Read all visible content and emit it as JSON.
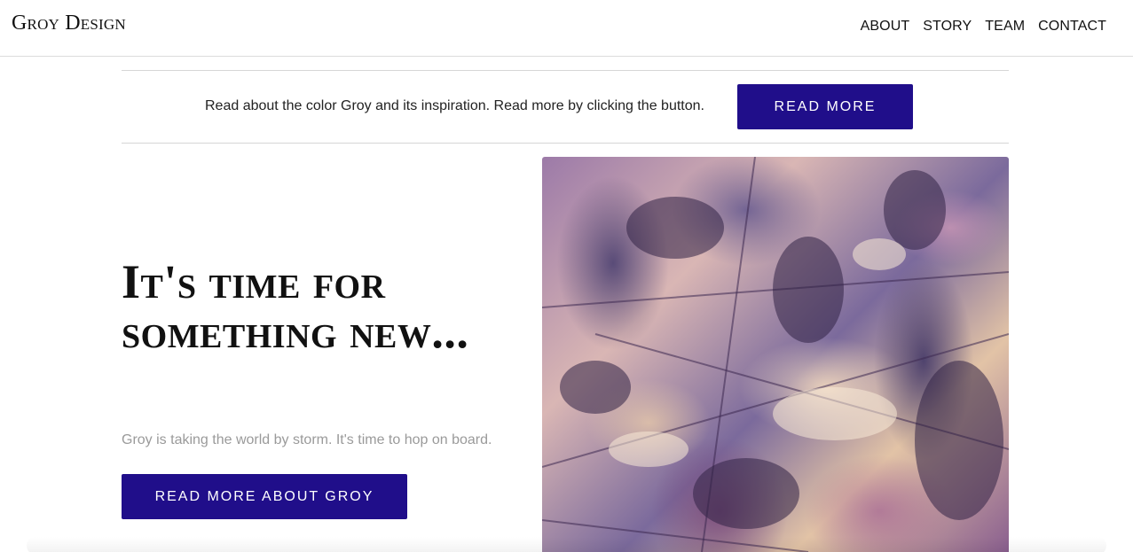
{
  "header": {
    "brand": "Groy Design",
    "nav": [
      "ABOUT",
      "STORY",
      "TEAM",
      "CONTACT"
    ]
  },
  "banner": {
    "text": "Read about the color Groy and its inspiration. Read more by clicking the button.",
    "button_label": "READ MORE"
  },
  "hero": {
    "title": "It's time for something new...",
    "subtitle": "Groy is taking the world by storm. It's time to hop on board.",
    "button_label": "READ MORE ABOUT GROY"
  },
  "colors": {
    "accent": "#200e8a",
    "muted_text": "#9a9a9a"
  }
}
